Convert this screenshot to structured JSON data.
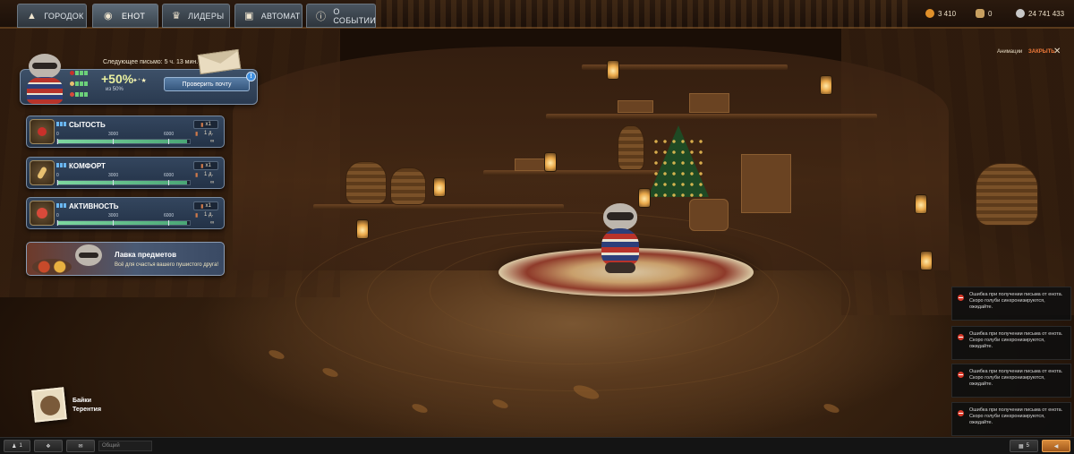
{
  "nav": {
    "tabs": [
      {
        "label": "ГОРОДОК",
        "icon": "town-icon"
      },
      {
        "label": "ЕНОТ",
        "icon": "raccoon-icon",
        "active": true
      },
      {
        "label": "ЛИДЕРЫ",
        "icon": "trophy-icon"
      },
      {
        "label": "АВТОМАТ",
        "icon": "slot-machine-icon"
      },
      {
        "label": "О СОБЫТИИ",
        "icon": "info-icon"
      }
    ],
    "resources": [
      {
        "value": "3 410",
        "icon": "coin-icon",
        "color": "#e0902a"
      },
      {
        "value": "0",
        "icon": "bag-icon",
        "color": "#c8a060"
      },
      {
        "value": "24 741 433",
        "icon": "silver-icon",
        "color": "#c8c8c8"
      }
    ]
  },
  "letter": {
    "next_label": "Следующее письмо: 5 ч. 13 мин.",
    "bonus": "+50%",
    "bonus_sub": "из 50%",
    "stars": "✦⁺★",
    "check_button": "Проверить почту",
    "badge": "!"
  },
  "stats": [
    {
      "title": "СЫТОСТЬ",
      "icon": "apple-icon",
      "icon_color": "#c8302a",
      "mult": "x1",
      "ticks": [
        "0",
        "3000",
        "6000"
      ],
      "time": "1 д.",
      "inf": "∞",
      "fill": 0.98
    },
    {
      "title": "КОМФОРТ",
      "icon": "brush-icon",
      "icon_color": "#e8c070",
      "mult": "x1",
      "ticks": [
        "0",
        "3000",
        "6000"
      ],
      "time": "1 д.",
      "inf": "∞",
      "fill": 0.98
    },
    {
      "title": "АКТИВНОСТЬ",
      "icon": "ball-icon",
      "icon_color": "#d84a3a",
      "mult": "x1",
      "ticks": [
        "0",
        "3000",
        "6000"
      ],
      "time": "1 д.",
      "inf": "∞",
      "fill": 0.98
    }
  ],
  "shop": {
    "title": "Лавка предметов",
    "subtitle": "Всё для счастья вашего пушистого друга!"
  },
  "animation": {
    "label": "Анимации",
    "close": "ЗАКРЫТЬ",
    "x": "✕"
  },
  "tales": {
    "line1": "Байки",
    "line2": "Терентия"
  },
  "notifications": [
    {
      "text": "Ошибка при получении письма от енота. Скоро голуби синхронизируются, ожидайте."
    },
    {
      "text": "Ошибка при получении письма от енота. Скоро голуби синхронизируются, ожидайте."
    },
    {
      "text": "Ошибка при получении письма от енота. Скоро голуби синхронизируются, ожидайте."
    },
    {
      "text": "Ошибка при получении письма от енота. Скоро голуби синхронизируются, ожидайте."
    }
  ],
  "bottom": {
    "players": "1",
    "chat_placeholder": "Общий",
    "count": "5"
  }
}
